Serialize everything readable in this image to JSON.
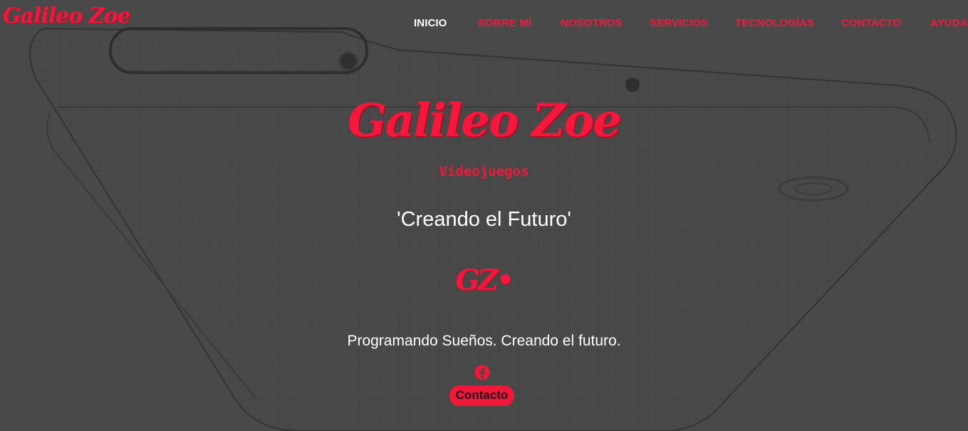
{
  "header": {
    "logo_text": "Galileo Zoe",
    "nav": [
      {
        "label": "INICIO",
        "active": true
      },
      {
        "label": "SOBRE MÍ",
        "active": false
      },
      {
        "label": "NOSOTROS",
        "active": false
      },
      {
        "label": "SERVICIOS",
        "active": false
      },
      {
        "label": "TECNOLOGÍAS",
        "active": false
      },
      {
        "label": "CONTACTO",
        "active": false
      },
      {
        "label": "AYUDA",
        "active": false
      }
    ]
  },
  "hero": {
    "title": "Galileo Zoe",
    "subtitle": "Videojuegos",
    "tagline": "'Creando el Futuro'",
    "mini_logo": "GZ•",
    "motto": "Programando Sueños. Creando el futuro.",
    "social_icon": "facebook-icon",
    "contact_button": "Contacto"
  },
  "colors": {
    "background": "#494949",
    "accent": "#f0183a",
    "text_light": "#ffffff"
  }
}
